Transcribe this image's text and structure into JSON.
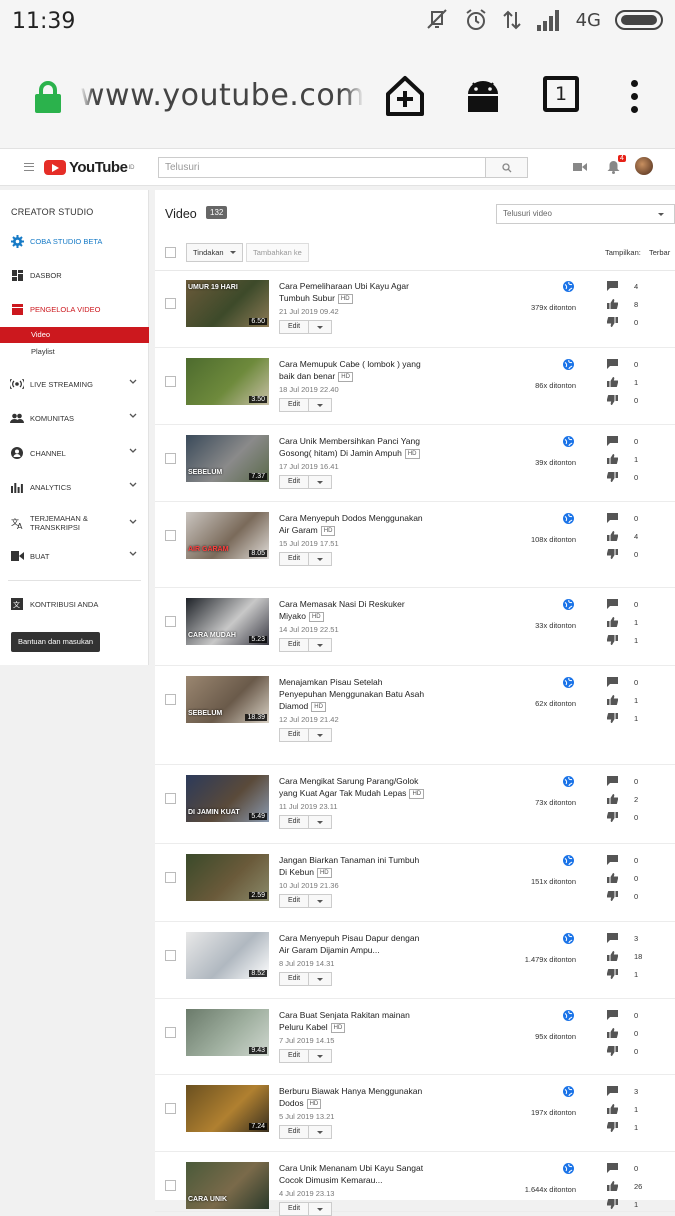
{
  "status": {
    "time": "11:39",
    "network": "4G"
  },
  "browser": {
    "url": "www.youtube.com/m",
    "tabs_count": "1"
  },
  "header": {
    "logo": "YouTube",
    "logo_sup": "ID",
    "search_placeholder": "Telusuri",
    "notif_count": "4"
  },
  "sidebar": {
    "title": "CREATOR STUDIO",
    "beta": "COBA STUDIO BETA",
    "items": [
      {
        "label": "DASBOR"
      },
      {
        "label": "PENGELOLA VIDEO"
      },
      {
        "label": "LIVE STREAMING"
      },
      {
        "label": "KOMUNITAS"
      },
      {
        "label": "CHANNEL"
      },
      {
        "label": "ANALYTICS"
      },
      {
        "label": "TERJEMAHAN & TRANSKRIPSI"
      },
      {
        "label": "BUAT"
      },
      {
        "label": "KONTRIBUSI ANDA"
      }
    ],
    "sub": [
      {
        "label": "Video"
      },
      {
        "label": "Playlist"
      }
    ],
    "help": "Bantuan dan masukan"
  },
  "main": {
    "title": "Video",
    "count": "132",
    "filter_placeholder": "Telusuri video",
    "actions": "Tindakan",
    "add_to": "Tambahkan ke",
    "view_label": "Tampilkan:",
    "view_value": "Terbar",
    "edit_label": "Edit",
    "hd_label": "HD"
  },
  "videos": [
    {
      "title": "Cara Pemeliharaan Ubi Kayu Agar Tumbuh Subur",
      "hd": true,
      "date": "21 Jul 2019 09.42",
      "views": "379x ditonton",
      "comments": "4",
      "likes": "8",
      "dislikes": "0",
      "duration": "6.50",
      "caption": "UMUR 19 HARI"
    },
    {
      "title": "Cara Memupuk Cabe ( lombok ) yang baik dan benar",
      "hd": true,
      "date": "18 Jul 2019 22.40",
      "views": "86x ditonton",
      "comments": "0",
      "likes": "1",
      "dislikes": "0",
      "duration": "3.50",
      "caption": ""
    },
    {
      "title": "Cara Unik Membersihkan Panci Yang Gosong( hitam) Di Jamin Ampuh",
      "hd": true,
      "date": "17 Jul 2019 16.41",
      "views": "39x ditonton",
      "comments": "0",
      "likes": "1",
      "dislikes": "0",
      "duration": "7.37",
      "caption": "SEBELUM"
    },
    {
      "title": "Cara Menyepuh Dodos Menggunakan Air Garam",
      "hd": true,
      "date": "15 Jul 2019 17.51",
      "views": "108x ditonton",
      "comments": "0",
      "likes": "4",
      "dislikes": "0",
      "duration": "8.05",
      "caption": "AIR GARAM"
    },
    {
      "title": "Cara Memasak Nasi Di Reskuker Miyako",
      "hd": true,
      "date": "14 Jul 2019 22.51",
      "views": "33x ditonton",
      "comments": "0",
      "likes": "1",
      "dislikes": "1",
      "duration": "5.23",
      "caption": "CARA MUDAH"
    },
    {
      "title": "Menajamkan Pisau Setelah Penyepuhan Menggunakan Batu Asah Diamod",
      "hd": true,
      "date": "12 Jul 2019 21.42",
      "views": "62x ditonton",
      "comments": "0",
      "likes": "1",
      "dislikes": "1",
      "duration": "18.39",
      "caption": "SEBELUM"
    },
    {
      "title": "Cara Mengikat Sarung Parang/Golok yang Kuat Agar Tak Mudah Lepas",
      "hd": true,
      "date": "11 Jul 2019 23.11",
      "views": "73x ditonton",
      "comments": "0",
      "likes": "2",
      "dislikes": "0",
      "duration": "5.49",
      "caption": "DI JAMIN KUAT"
    },
    {
      "title": "Jangan Biarkan Tanaman ini Tumbuh Di Kebun",
      "hd": true,
      "date": "10 Jul 2019 21.36",
      "views": "151x ditonton",
      "comments": "0",
      "likes": "0",
      "dislikes": "0",
      "duration": "2.59",
      "caption": ""
    },
    {
      "title": "Cara Menyepuh Pisau Dapur dengan Air Garam Dijamin Ampu...",
      "hd": false,
      "date": "8 Jul 2019 14.31",
      "views": "1.479x ditonton",
      "comments": "3",
      "likes": "18",
      "dislikes": "1",
      "duration": "8.52",
      "caption": ""
    },
    {
      "title": "Cara Buat Senjata Rakitan mainan Peluru Kabel",
      "hd": true,
      "date": "7 Jul 2019 14.15",
      "views": "95x ditonton",
      "comments": "0",
      "likes": "0",
      "dislikes": "0",
      "duration": "9.43",
      "caption": ""
    },
    {
      "title": "Berburu Biawak Hanya Menggunakan Dodos",
      "hd": true,
      "date": "5 Jul 2019 13.21",
      "views": "197x ditonton",
      "comments": "3",
      "likes": "1",
      "dislikes": "1",
      "duration": "7.24",
      "caption": ""
    },
    {
      "title": "Cara Unik Menanam Ubi Kayu Sangat Cocok Dimusim Kemarau...",
      "hd": false,
      "date": "4 Jul 2019 23.13",
      "views": "1.644x ditonton",
      "comments": "0",
      "likes": "26",
      "dislikes": "1",
      "duration": "",
      "caption": "CARA UNIK"
    }
  ],
  "colors": {
    "accent": "#cc181e",
    "globe": "#1a73e8",
    "lock": "#2bb24c"
  }
}
